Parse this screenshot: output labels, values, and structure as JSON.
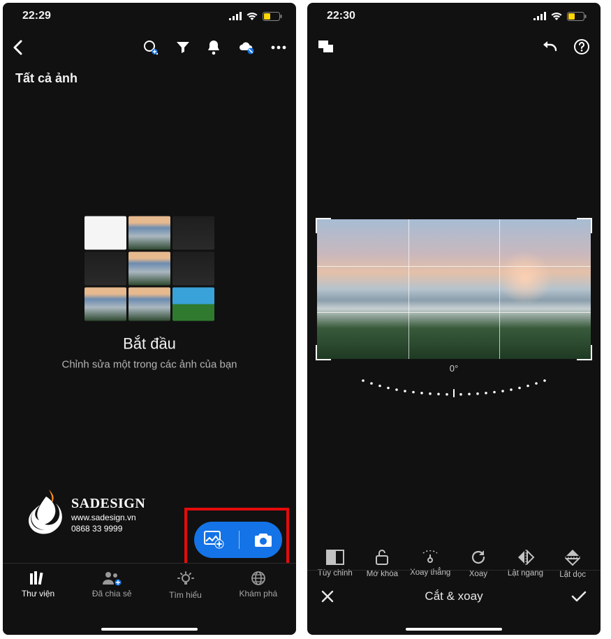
{
  "phones": [
    {
      "time": "22:29",
      "toolbar_icons": [
        "back",
        "search",
        "filter",
        "bell",
        "cloud",
        "more"
      ],
      "page_title": "Tất cả ảnh",
      "getting_started": {
        "title": "Bắt đầu",
        "subtitle": "Chỉnh sửa một trong các ảnh của bạn"
      },
      "watermark": {
        "brand": "SADESIGN",
        "url": "www.sadesign.vn",
        "phone": "0868 33 9999"
      },
      "tabs": [
        {
          "label": "Thư viện",
          "active": true
        },
        {
          "label": "Đã chia sẻ",
          "active": false
        },
        {
          "label": "Tìm hiểu",
          "active": false
        },
        {
          "label": "Khám phá",
          "active": false
        }
      ]
    },
    {
      "time": "22:30",
      "angle": "0°",
      "tools": [
        {
          "label": "Tùy chỉnh"
        },
        {
          "label": "Mở khóa"
        },
        {
          "label": "Xoay thẳng"
        },
        {
          "label": "Xoay"
        },
        {
          "label": "Lật ngang"
        },
        {
          "label": "Lật dọc"
        }
      ],
      "confirm_title": "Cắt & xoay"
    }
  ]
}
